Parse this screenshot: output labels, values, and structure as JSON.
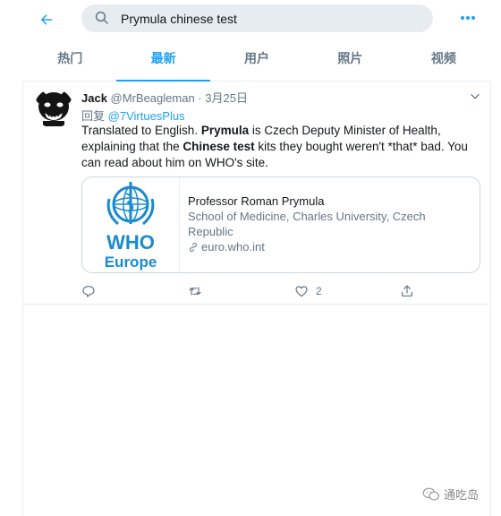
{
  "search": {
    "query": "Prymula chinese test"
  },
  "tabs": [
    {
      "label": "热门"
    },
    {
      "label": "最新"
    },
    {
      "label": "用户"
    },
    {
      "label": "照片"
    },
    {
      "label": "视频"
    }
  ],
  "tweet": {
    "name": "Jack",
    "handle": "@MrBeagleman",
    "separator": "·",
    "date": "3月25日",
    "reply_prefix": "回复",
    "reply_to": "@7VirtuesPlus",
    "text": {
      "p1": "Translated to English. ",
      "b1": "Prymula",
      "p2": " is Czech Deputy Minister of Health, explaining that the ",
      "b2": "Chinese test",
      "p3": " kits they bought weren't *that* bad. You can read about him on WHO's site."
    },
    "card": {
      "logo_text_1": "WHO",
      "logo_text_2": "Europe",
      "title": "Professor Roman Prymula",
      "description": "School of Medicine, Charles University, Czech Republic",
      "domain": "euro.who.int"
    },
    "actions": {
      "like_count": "2"
    }
  },
  "watermark": {
    "text": "通吃岛"
  },
  "colors": {
    "accent": "#1da1f2",
    "who_blue": "#1a8bcf",
    "muted": "#657786"
  }
}
